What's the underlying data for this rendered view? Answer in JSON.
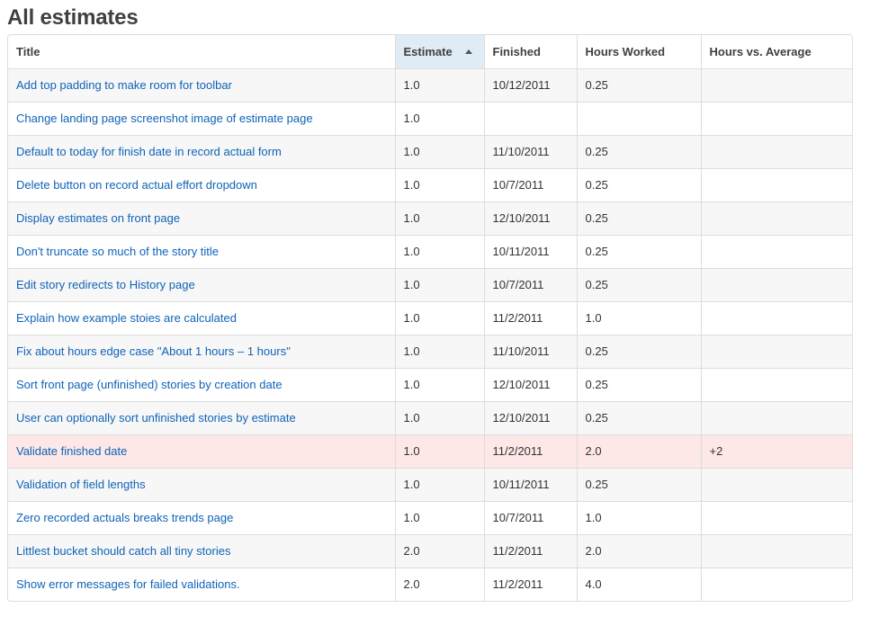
{
  "page": {
    "title": "All estimates"
  },
  "table": {
    "columns": [
      {
        "key": "title",
        "label": "Title"
      },
      {
        "key": "estimate",
        "label": "Estimate"
      },
      {
        "key": "finished",
        "label": "Finished"
      },
      {
        "key": "hours_worked",
        "label": "Hours Worked"
      },
      {
        "key": "hours_vs_average",
        "label": "Hours vs. Average"
      }
    ],
    "sorted_by": "estimate",
    "sort_direction": "ascending",
    "sort_icon": "triangle-up-icon",
    "highlight_color": "#fde7e7",
    "sort_header_color": "#dfecf5",
    "link_color": "#0f63b8",
    "rows": [
      {
        "title": "Add top padding to make room for toolbar",
        "estimate": "1.0",
        "finished": "10/12/2011",
        "hours_worked": "0.25",
        "hours_vs_average": "",
        "flagged": false
      },
      {
        "title": "Change landing page screenshot image of estimate page",
        "estimate": "1.0",
        "finished": "",
        "hours_worked": "",
        "hours_vs_average": "",
        "flagged": false
      },
      {
        "title": "Default to today for finish date in record actual form",
        "estimate": "1.0",
        "finished": "11/10/2011",
        "hours_worked": "0.25",
        "hours_vs_average": "",
        "flagged": false
      },
      {
        "title": "Delete button on record actual effort dropdown",
        "estimate": "1.0",
        "finished": "10/7/2011",
        "hours_worked": "0.25",
        "hours_vs_average": "",
        "flagged": false
      },
      {
        "title": "Display estimates on front page",
        "estimate": "1.0",
        "finished": "12/10/2011",
        "hours_worked": "0.25",
        "hours_vs_average": "",
        "flagged": false
      },
      {
        "title": "Don't truncate so much of the story title",
        "estimate": "1.0",
        "finished": "10/11/2011",
        "hours_worked": "0.25",
        "hours_vs_average": "",
        "flagged": false
      },
      {
        "title": "Edit story redirects to History page",
        "estimate": "1.0",
        "finished": "10/7/2011",
        "hours_worked": "0.25",
        "hours_vs_average": "",
        "flagged": false
      },
      {
        "title": "Explain how example stoies are calculated",
        "estimate": "1.0",
        "finished": "11/2/2011",
        "hours_worked": "1.0",
        "hours_vs_average": "",
        "flagged": false
      },
      {
        "title": "Fix about hours edge case \"About 1 hours – 1 hours\"",
        "estimate": "1.0",
        "finished": "11/10/2011",
        "hours_worked": "0.25",
        "hours_vs_average": "",
        "flagged": false
      },
      {
        "title": "Sort front page (unfinished) stories by creation date",
        "estimate": "1.0",
        "finished": "12/10/2011",
        "hours_worked": "0.25",
        "hours_vs_average": "",
        "flagged": false
      },
      {
        "title": "User can optionally sort unfinished stories by estimate",
        "estimate": "1.0",
        "finished": "12/10/2011",
        "hours_worked": "0.25",
        "hours_vs_average": "",
        "flagged": false
      },
      {
        "title": "Validate finished date",
        "estimate": "1.0",
        "finished": "11/2/2011",
        "hours_worked": "2.0",
        "hours_vs_average": "+2",
        "flagged": true
      },
      {
        "title": "Validation of field lengths",
        "estimate": "1.0",
        "finished": "10/11/2011",
        "hours_worked": "0.25",
        "hours_vs_average": "",
        "flagged": false
      },
      {
        "title": "Zero recorded actuals breaks trends page",
        "estimate": "1.0",
        "finished": "10/7/2011",
        "hours_worked": "1.0",
        "hours_vs_average": "",
        "flagged": false
      },
      {
        "title": "Littlest bucket should catch all tiny stories",
        "estimate": "2.0",
        "finished": "11/2/2011",
        "hours_worked": "2.0",
        "hours_vs_average": "",
        "flagged": false
      },
      {
        "title": "Show error messages for failed validations.",
        "estimate": "2.0",
        "finished": "11/2/2011",
        "hours_worked": "4.0",
        "hours_vs_average": "",
        "flagged": false
      }
    ]
  }
}
